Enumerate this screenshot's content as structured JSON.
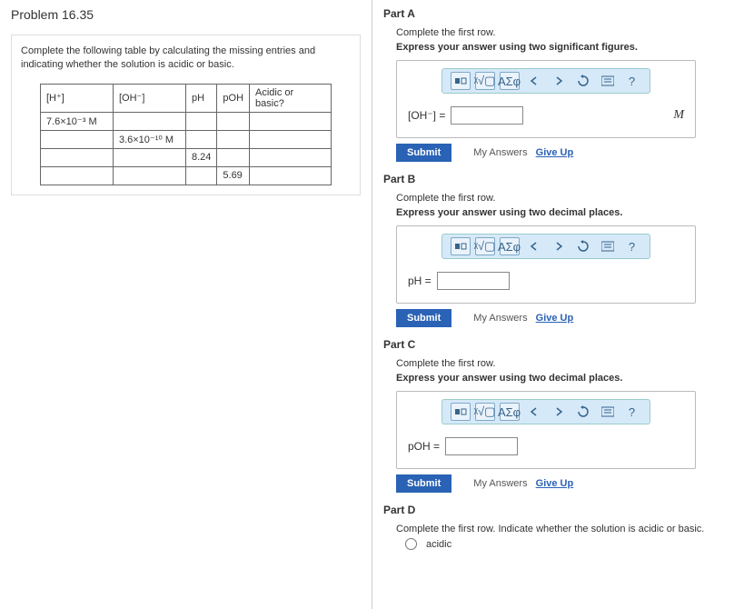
{
  "problem": {
    "title": "Problem 16.35",
    "prompt": "Complete the following table by calculating the missing entries and indicating whether the solution is acidic or basic.",
    "table": {
      "headers": {
        "h": "[H⁺]",
        "oh": "[OH⁻]",
        "ph": "pH",
        "poh": "pOH",
        "ab": "Acidic or basic?"
      },
      "rows": [
        {
          "h": "7.6×10⁻³ M",
          "oh": "",
          "ph": "",
          "poh": "",
          "ab": ""
        },
        {
          "h": "",
          "oh": "3.6×10⁻¹⁰ M",
          "ph": "",
          "poh": "",
          "ab": ""
        },
        {
          "h": "",
          "oh": "",
          "ph": "8.24",
          "poh": "",
          "ab": ""
        },
        {
          "h": "",
          "oh": "",
          "ph": "",
          "poh": "5.69",
          "ab": ""
        }
      ]
    }
  },
  "parts": {
    "A": {
      "title": "Part A",
      "instr1": "Complete the first row.",
      "instr2": "Express your answer using two significant figures.",
      "lhs": "[OH⁻] =",
      "unit": "M"
    },
    "B": {
      "title": "Part B",
      "instr1": "Complete the first row.",
      "instr2": "Express your answer using two decimal places.",
      "lhs": "pH =",
      "unit": ""
    },
    "C": {
      "title": "Part C",
      "instr1": "Complete the first row.",
      "instr2": "Express your answer using two decimal places.",
      "lhs": "pOH =",
      "unit": ""
    },
    "D": {
      "title": "Part D",
      "instr1": "Complete the first row. Indicate whether the solution is acidic or basic.",
      "option1": "acidic"
    }
  },
  "ui": {
    "submit": "Submit",
    "myAnswers": "My Answers",
    "giveUp": "Give Up",
    "toolbar": {
      "sqrt": "ᵡ√▢",
      "greek": "ΑΣφ",
      "help": "?"
    }
  }
}
